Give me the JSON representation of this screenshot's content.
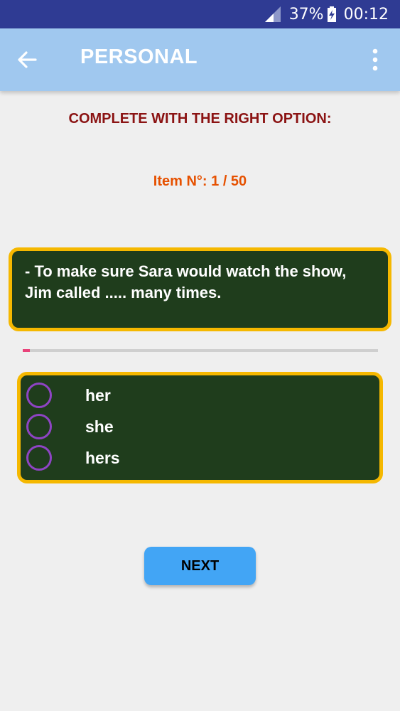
{
  "status_bar": {
    "battery": "37%",
    "time": "00:12"
  },
  "app_bar": {
    "title": "PERSONAL",
    "back_icon": "arrow-left-icon",
    "menu_icon": "more-vertical-icon",
    "background": "#a0c8ef"
  },
  "instruction": "COMPLETE WITH THE RIGHT OPTION:",
  "item_counter": "Item N°: 1 / 50",
  "question": "- To make sure Sara would watch the show, Jim called ..... many times.",
  "progress": {
    "current": 1,
    "total": 50
  },
  "options": [
    {
      "label": "her",
      "selected": false
    },
    {
      "label": "she",
      "selected": false
    },
    {
      "label": "hers",
      "selected": false
    }
  ],
  "next_button": {
    "label": "NEXT",
    "color": "#42a5f5"
  },
  "colors": {
    "box_background": "#1f3d1c",
    "box_border": "#f5b800",
    "radio": "#8e44c4",
    "progress": "#e9437a"
  }
}
